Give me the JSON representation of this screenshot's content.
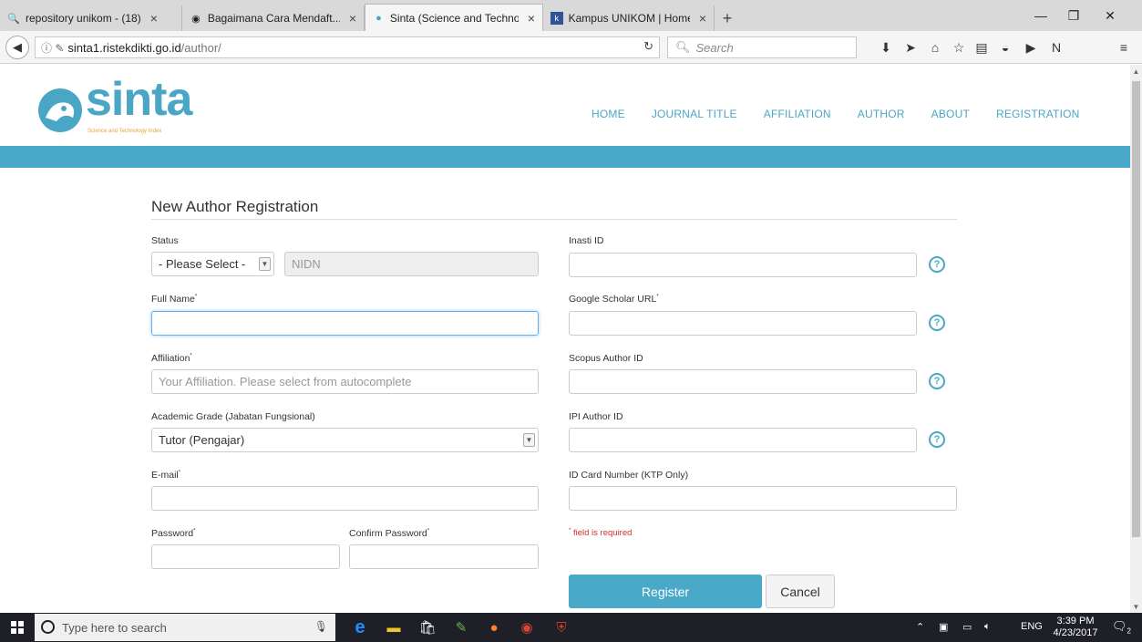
{
  "browser": {
    "tabs": [
      {
        "label": "repository unikom - (18)",
        "icon": "search-icon"
      },
      {
        "label": "Bagaimana Cara Mendaft...",
        "icon": "circle-icon"
      },
      {
        "label": "Sinta (Science and Techno...",
        "icon": "sinta-icon",
        "active": true
      },
      {
        "label": "Kampus UNIKOM | Home",
        "icon": "unikom-icon"
      }
    ],
    "new_tab": "+",
    "url_host": "sinta1.ristekdikti.go.id",
    "url_path": "/author/",
    "search_placeholder": "Search"
  },
  "site": {
    "brand": "sinta",
    "tagline": "Science and Technology Index",
    "nav": [
      "HOME",
      "JOURNAL TITLE",
      "AFFILIATION",
      "AUTHOR",
      "ABOUT",
      "REGISTRATION"
    ]
  },
  "form": {
    "title": "New Author Registration",
    "status_label": "Status",
    "status_value": "- Please Select -",
    "nidn_placeholder": "NIDN",
    "fullname_label": "Full Name",
    "affiliation_label": "Affiliation",
    "affiliation_placeholder": "Your Affiliation. Please select from autocomplete",
    "grade_label": "Academic Grade (Jabatan Fungsional)",
    "grade_value": "Tutor (Pengajar)",
    "email_label": "E-mail",
    "password_label": "Password",
    "confirm_label": "Confirm Password",
    "inasti_label": "Inasti ID",
    "scholar_label": "Google Scholar URL",
    "scopus_label": "Scopus Author ID",
    "ipi_label": "IPI Author ID",
    "ktp_label": "ID Card Number (KTP Only)",
    "required_note": "field is required",
    "required_mark": "*",
    "help_mark": "?",
    "register_label": "Register",
    "cancel_label": "Cancel"
  },
  "taskbar": {
    "search_placeholder": "Type here to search",
    "language": "ENG",
    "time": "3:39 PM",
    "date": "4/23/2017",
    "notification_count": "2"
  },
  "colors": {
    "accent": "#4aa9c8",
    "required": "#c9302c"
  }
}
